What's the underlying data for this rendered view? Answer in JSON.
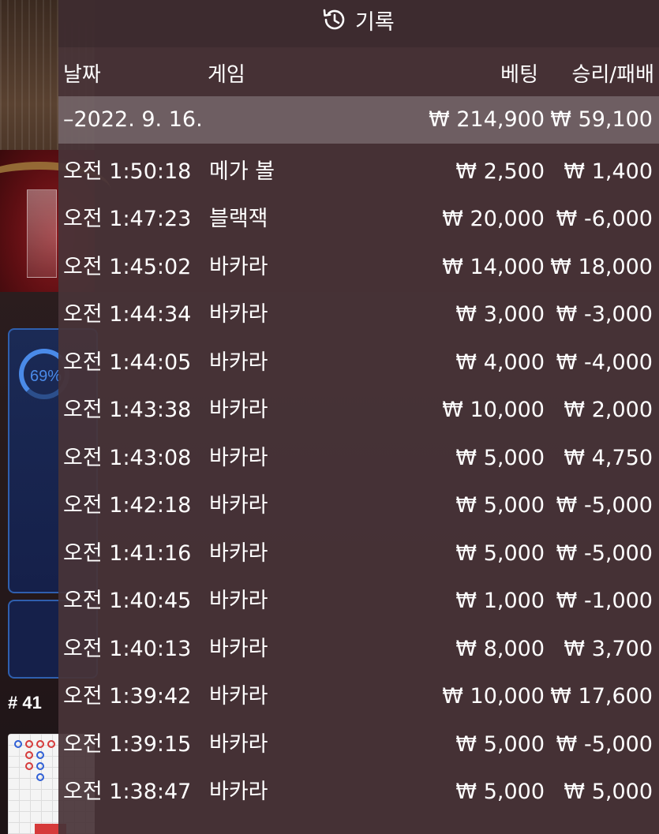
{
  "overlay": {
    "title": "기록",
    "icon": "history-icon",
    "columns": {
      "date": "날짜",
      "game": "게임",
      "bet": "베팅",
      "win_loss": "승리/패배"
    },
    "summary": {
      "date": "–2022. 9. 16.",
      "bet": "₩ 214,900",
      "win_loss": "₩ 59,100"
    },
    "rows": [
      {
        "time": "오전 1:50:18",
        "game": "메가 볼",
        "bet": "₩ 2,500",
        "win_loss": "₩ 1,400"
      },
      {
        "time": "오전 1:47:23",
        "game": "블랙잭",
        "bet": "₩ 20,000",
        "win_loss": "₩ -6,000"
      },
      {
        "time": "오전 1:45:02",
        "game": "바카라",
        "bet": "₩ 14,000",
        "win_loss": "₩ 18,000"
      },
      {
        "time": "오전 1:44:34",
        "game": "바카라",
        "bet": "₩ 3,000",
        "win_loss": "₩ -3,000"
      },
      {
        "time": "오전 1:44:05",
        "game": "바카라",
        "bet": "₩ 4,000",
        "win_loss": "₩ -4,000"
      },
      {
        "time": "오전 1:43:38",
        "game": "바카라",
        "bet": "₩ 10,000",
        "win_loss": "₩ 2,000"
      },
      {
        "time": "오전 1:43:08",
        "game": "바카라",
        "bet": "₩ 5,000",
        "win_loss": "₩ 4,750"
      },
      {
        "time": "오전 1:42:18",
        "game": "바카라",
        "bet": "₩ 5,000",
        "win_loss": "₩ -5,000"
      },
      {
        "time": "오전 1:41:16",
        "game": "바카라",
        "bet": "₩ 5,000",
        "win_loss": "₩ -5,000"
      },
      {
        "time": "오전 1:40:45",
        "game": "바카라",
        "bet": "₩ 1,000",
        "win_loss": "₩ -1,000"
      },
      {
        "time": "오전 1:40:13",
        "game": "바카라",
        "bet": "₩ 8,000",
        "win_loss": "₩ 3,700"
      },
      {
        "time": "오전 1:39:42",
        "game": "바카라",
        "bet": "₩ 10,000",
        "win_loss": "₩ 17,600"
      },
      {
        "time": "오전 1:39:15",
        "game": "바카라",
        "bet": "₩ 5,000",
        "win_loss": "₩ -5,000"
      },
      {
        "time": "오전 1:38:47",
        "game": "바카라",
        "bet": "₩ 5,000",
        "win_loss": "₩ 5,000"
      }
    ]
  },
  "background": {
    "bet_percent": "69%",
    "round_label": "# 41"
  }
}
